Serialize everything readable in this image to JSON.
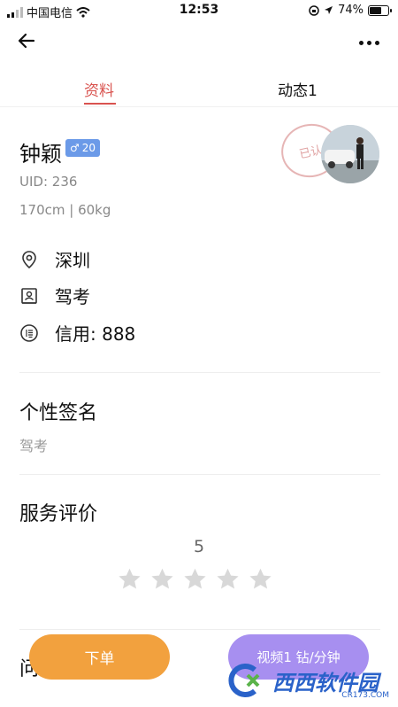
{
  "status_bar": {
    "carrier": "中国电信",
    "time": "12:53",
    "battery": "74%",
    "battery_level": 0.74
  },
  "nav": {
    "back_icon": "arrow-left-icon",
    "more_icon": "more-dots-icon"
  },
  "tabs": [
    {
      "label": "资料",
      "active": true
    },
    {
      "label": "动态1",
      "active": false
    }
  ],
  "profile": {
    "name": "钟颖",
    "gender_symbol": "♂",
    "age": "20",
    "uid": "UID: 236",
    "height_weight": "170cm | 60kg",
    "stamp_text": "已认"
  },
  "info": {
    "city": "深圳",
    "occupation": "驾考",
    "credit": "信用: 888"
  },
  "signature": {
    "title": "个性签名",
    "text": "驾考"
  },
  "reviews": {
    "title": "服务评价",
    "score": "5",
    "stars_total": 5,
    "star_color": "#d8d8d8"
  },
  "partial_section_title": "问",
  "actions": {
    "order": "下单",
    "video": "视频1 钻/分钟"
  },
  "watermark": {
    "text": "西西软件园",
    "url": "CR173.COM"
  },
  "colors": {
    "accent_red": "#d9534f",
    "order_button": "#f2a13e",
    "video_button": "#a78ff0",
    "gender_badge": "#6b9ae8"
  }
}
